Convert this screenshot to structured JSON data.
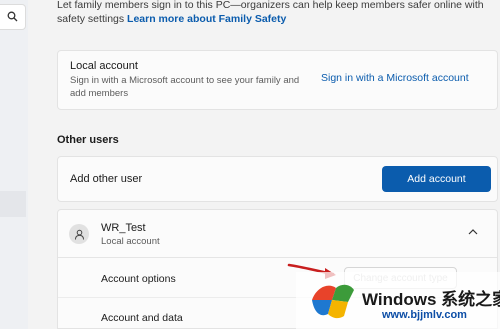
{
  "intro": {
    "line1": "Let family members sign in to this PC—organizers can help keep members safer online with",
    "line2_prefix": "safety settings ",
    "family_link": "Learn more about Family Safety"
  },
  "local_account": {
    "title": "Local account",
    "description": "Sign in with a Microsoft account to see your family and add members",
    "link": "Sign in with a Microsoft account"
  },
  "other_users": {
    "heading": "Other users",
    "add_label": "Add other user",
    "add_button": "Add account",
    "user": {
      "name": "WR_Test",
      "type": "Local account",
      "options": [
        {
          "label": "Account options",
          "button": "Change account type"
        },
        {
          "label": "Account and data"
        }
      ]
    }
  },
  "watermark": {
    "title": "Windows 系统之家",
    "url": "www.bjjmlv.com"
  },
  "colors": {
    "accent": "#0b5cad",
    "arrow": "#c81e1e"
  }
}
